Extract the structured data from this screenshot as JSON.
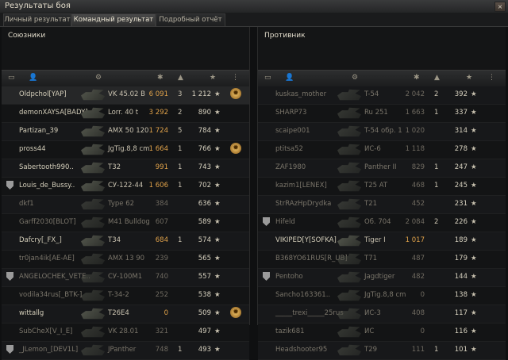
{
  "window": {
    "title": "Результаты боя",
    "close_glyph": "×"
  },
  "tabs": [
    {
      "label": "Личный результат"
    },
    {
      "label": "Командный результат"
    },
    {
      "label": "Подробный отчёт"
    }
  ],
  "allies": {
    "title": "Союзники",
    "rows": [
      {
        "name": "Oldpchol[YAP]",
        "tank": "VK 45.02 B",
        "damage": "6 091",
        "frags": "3",
        "xp": "1 212",
        "medal": true,
        "dead": false,
        "hl": true
      },
      {
        "name": "demonXAYSA[BADY]",
        "tank": "Lorr. 40 t",
        "damage": "3 292",
        "frags": "2",
        "xp": "890",
        "dead": false
      },
      {
        "name": "Partizan_39",
        "tank": "AMX 50 120",
        "damage": "1 724",
        "frags": "5",
        "xp": "784",
        "dead": false
      },
      {
        "name": "pross44",
        "tank": "JgTig.8,8 cm",
        "damage": "1 664",
        "frags": "1",
        "xp": "766",
        "medal": true,
        "dead": false
      },
      {
        "name": "Sabertooth990..",
        "tank": "T32",
        "damage": "991",
        "frags": "1",
        "xp": "743",
        "dead": false
      },
      {
        "name": "Louis_de_Bussy..",
        "tank": "СУ-122-44",
        "damage": "1 606",
        "frags": "1",
        "xp": "702",
        "clan": true,
        "dead": false
      },
      {
        "name": "dkf1",
        "tank": "Type 62",
        "damage": "384",
        "frags": "",
        "xp": "636",
        "dead": true
      },
      {
        "name": "Garff2030[BLOT]",
        "tank": "M41 Bulldog",
        "damage": "607",
        "frags": "",
        "xp": "589",
        "dead": true
      },
      {
        "name": "Dafcry[_FX_]",
        "tank": "T34",
        "damage": "684",
        "frags": "1",
        "xp": "574",
        "dead": false
      },
      {
        "name": "tr0jan4ik[AE-AE]",
        "tank": "AMX 13 90",
        "damage": "239",
        "frags": "",
        "xp": "565",
        "dead": true
      },
      {
        "name": "ANGELOCHEK_VETE..",
        "tank": "СУ-100М1",
        "damage": "740",
        "frags": "",
        "xp": "557",
        "clan": true,
        "dead": true
      },
      {
        "name": "vodila34rus[_BTK-]",
        "tank": "T-34-2",
        "damage": "252",
        "frags": "",
        "xp": "538",
        "dead": true
      },
      {
        "name": "wittallg",
        "tank": "T26E4",
        "damage": "0",
        "frags": "",
        "xp": "509",
        "medal": true,
        "dead": false
      },
      {
        "name": "SubCheX[V_I_E]",
        "tank": "VK 28.01",
        "damage": "321",
        "frags": "",
        "xp": "497",
        "dead": true
      },
      {
        "name": "_JLemon_[DEV1L]",
        "tank": "JPanther",
        "damage": "748",
        "frags": "1",
        "xp": "493",
        "clan": true,
        "dead": true
      }
    ]
  },
  "enemies": {
    "title": "Противник",
    "rows": [
      {
        "name": "kuskas_mother",
        "tank": "T-54",
        "damage": "2 042",
        "frags": "2",
        "xp": "392",
        "dead": true
      },
      {
        "name": "SHARP73",
        "tank": "Ru 251",
        "damage": "1 663",
        "frags": "1",
        "xp": "337",
        "dead": true
      },
      {
        "name": "scaipe001",
        "tank": "T-54 обр. 1",
        "damage": "1 020",
        "frags": "",
        "xp": "314",
        "dead": true
      },
      {
        "name": "ptitsa52",
        "tank": "ИС-6",
        "damage": "1 118",
        "frags": "",
        "xp": "278",
        "dead": true
      },
      {
        "name": "ZAF1980",
        "tank": "Panther II",
        "damage": "829",
        "frags": "1",
        "xp": "247",
        "dead": true
      },
      {
        "name": "kazim1[LENEX]",
        "tank": "T25 AT",
        "damage": "468",
        "frags": "1",
        "xp": "245",
        "dead": true
      },
      {
        "name": "StrRAzHpDrydka",
        "tank": "T21",
        "damage": "452",
        "frags": "",
        "xp": "231",
        "dead": true
      },
      {
        "name": "Hifeld",
        "tank": "Об. 704",
        "damage": "2 084",
        "frags": "2",
        "xp": "226",
        "clan": true,
        "dead": true
      },
      {
        "name": "VIKIPED[Y[SOFKA]",
        "tank": "Tiger I",
        "damage": "1 017",
        "frags": "",
        "xp": "189",
        "dead": false
      },
      {
        "name": "B368YO61RUS[R_UB]",
        "tank": "T71",
        "damage": "487",
        "frags": "",
        "xp": "179",
        "dead": true
      },
      {
        "name": "Pentoho",
        "tank": "Jagdtiger",
        "damage": "482",
        "frags": "",
        "xp": "144",
        "clan": true,
        "dead": true
      },
      {
        "name": "Sancho163361..",
        "tank": "JgTig.8,8 cm",
        "damage": "0",
        "frags": "",
        "xp": "138",
        "dead": true
      },
      {
        "name": "_____trexi_____25rus",
        "tank": "ИС-3",
        "damage": "408",
        "frags": "",
        "xp": "117",
        "dead": true
      },
      {
        "name": "tazik681",
        "tank": "ИС",
        "damage": "0",
        "frags": "",
        "xp": "116",
        "dead": true
      },
      {
        "name": "Headshooter95",
        "tank": "T29",
        "damage": "111",
        "frags": "1",
        "xp": "101",
        "dead": true
      }
    ]
  },
  "columns": {
    "star": "★",
    "medal_glyph": "✹"
  }
}
